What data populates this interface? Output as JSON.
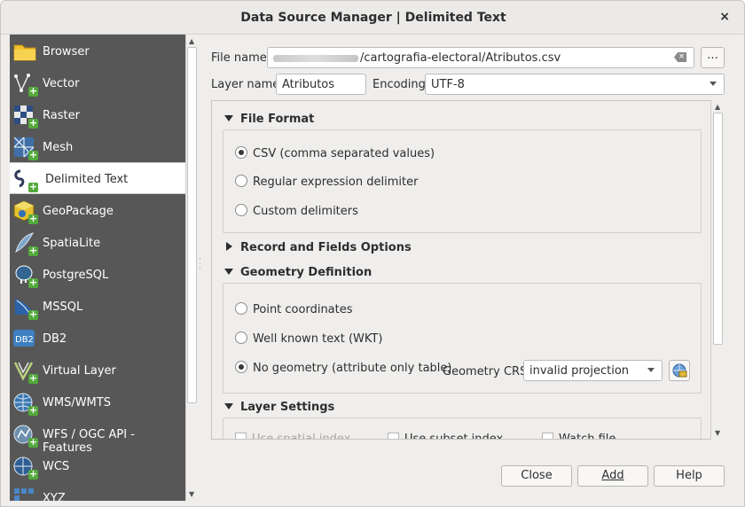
{
  "window": {
    "title": "Data Source Manager | Delimited Text",
    "close_glyph": "×"
  },
  "sidebar": {
    "items": [
      {
        "label": "Browser",
        "icon": "folder-icon"
      },
      {
        "label": "Vector",
        "icon": "vector-icon"
      },
      {
        "label": "Raster",
        "icon": "raster-icon"
      },
      {
        "label": "Mesh",
        "icon": "mesh-icon"
      },
      {
        "label": "Delimited Text",
        "icon": "delimited-text-icon",
        "active": true
      },
      {
        "label": "GeoPackage",
        "icon": "geopackage-icon"
      },
      {
        "label": "SpatiaLite",
        "icon": "spatialite-icon"
      },
      {
        "label": "PostgreSQL",
        "icon": "postgresql-icon"
      },
      {
        "label": "MSSQL",
        "icon": "mssql-icon"
      },
      {
        "label": "DB2",
        "icon": "db2-icon"
      },
      {
        "label": "Virtual Layer",
        "icon": "virtual-layer-icon"
      },
      {
        "label": "WMS/WMTS",
        "icon": "wms-icon"
      },
      {
        "label": "WFS / OGC API - Features",
        "icon": "wfs-icon"
      },
      {
        "label": "WCS",
        "icon": "wcs-icon"
      },
      {
        "label": "XYZ",
        "icon": "xyz-icon"
      }
    ]
  },
  "form": {
    "file_name_label": "File name",
    "file_name_value": "/cartografia-electoral/Atributos.csv",
    "browse_label": "…",
    "layer_name_label": "Layer name",
    "layer_name_value": "Atributos",
    "encoding_label": "Encoding",
    "encoding_value": "UTF-8"
  },
  "file_format": {
    "header": "File Format",
    "options": [
      "CSV (comma separated values)",
      "Regular expression delimiter",
      "Custom delimiters"
    ],
    "selected": 0
  },
  "record_fields": {
    "header": "Record and Fields Options"
  },
  "geometry": {
    "header": "Geometry Definition",
    "options": [
      "Point coordinates",
      "Well known text (WKT)",
      "No geometry (attribute only table)"
    ],
    "selected": 2,
    "crs_label": "Geometry CRS",
    "crs_value": "invalid projection"
  },
  "layer_settings": {
    "header": "Layer Settings",
    "checkboxes": [
      "Use spatial index",
      "Use subset index",
      "Watch file"
    ]
  },
  "footer": {
    "close": "Close",
    "add": "Add",
    "help": "Help"
  },
  "colors": {
    "sidebar_bg": "#575757",
    "plus_green": "#53a93b"
  }
}
